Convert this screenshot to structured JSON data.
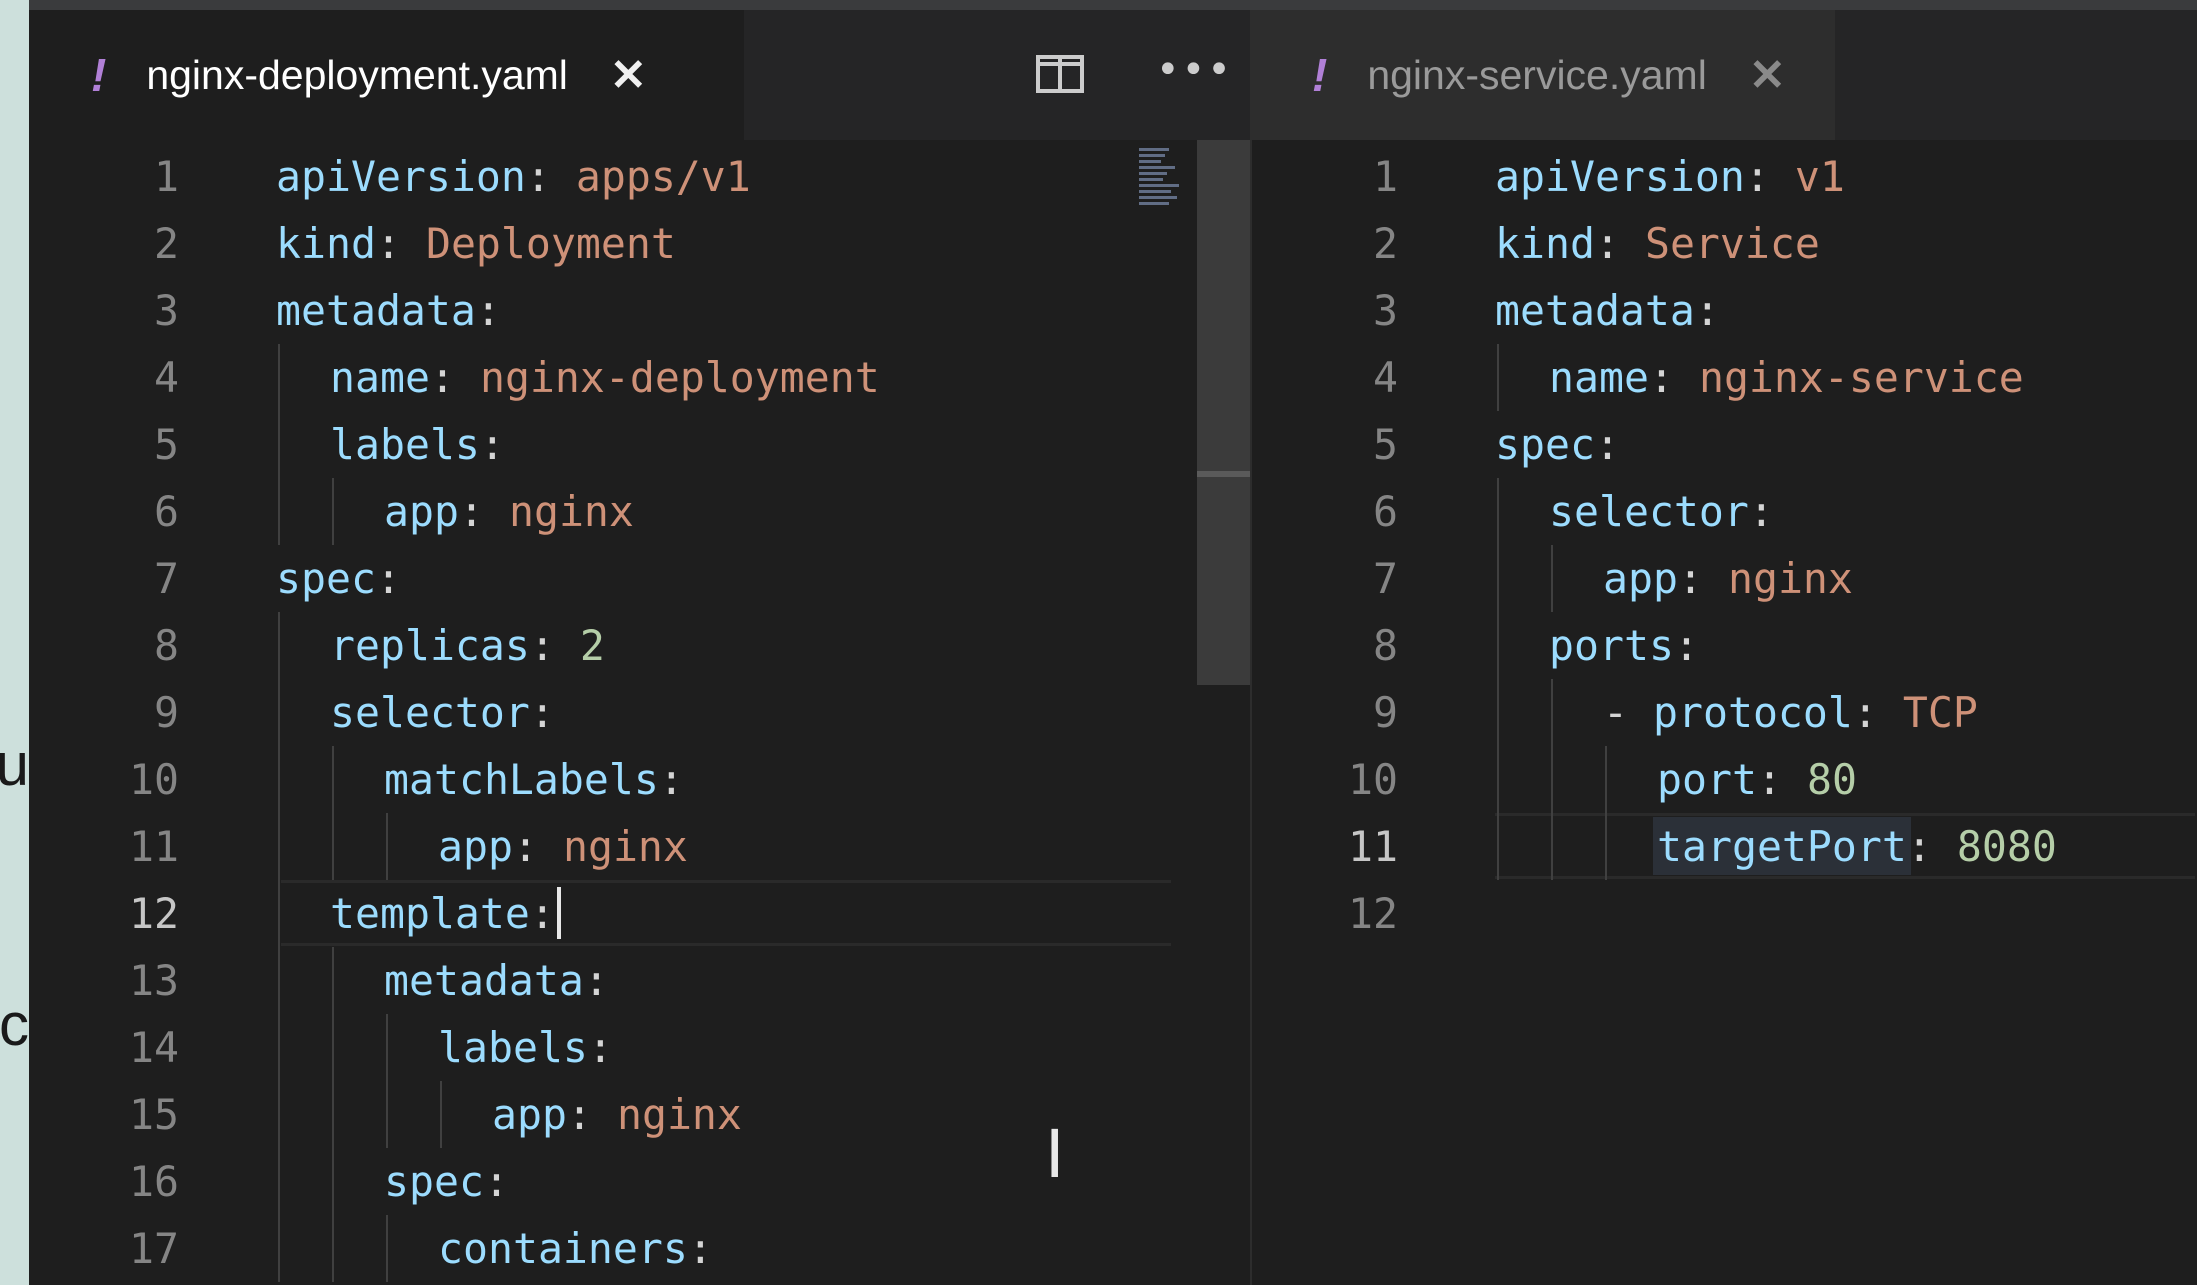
{
  "background_fragments": [
    "u",
    "c"
  ],
  "colors": {
    "key": "#9cdcfe",
    "string": "#ce9178",
    "number": "#b5cea8",
    "punctuation": "#d4d4d4",
    "line_number": "#858585",
    "tab_bang": "#b180d7"
  },
  "left_pane": {
    "tab": {
      "icon": "!",
      "filename": "nginx-deployment.yaml",
      "close": "✕",
      "active": true
    },
    "toolbar": {
      "split_icon": "split-editor-icon",
      "more": "•••"
    },
    "lines": [
      {
        "num": "1",
        "indent": 0,
        "key": "apiVersion",
        "value": "apps/v1",
        "vtype": "s"
      },
      {
        "num": "2",
        "indent": 0,
        "key": "kind",
        "value": "Deployment",
        "vtype": "s"
      },
      {
        "num": "3",
        "indent": 0,
        "key": "metadata",
        "value": "",
        "vtype": ""
      },
      {
        "num": "4",
        "indent": 1,
        "key": "name",
        "value": "nginx-deployment",
        "vtype": "s"
      },
      {
        "num": "5",
        "indent": 1,
        "key": "labels",
        "value": "",
        "vtype": ""
      },
      {
        "num": "6",
        "indent": 2,
        "key": "app",
        "value": "nginx",
        "vtype": "s"
      },
      {
        "num": "7",
        "indent": 0,
        "key": "spec",
        "value": "",
        "vtype": ""
      },
      {
        "num": "8",
        "indent": 1,
        "key": "replicas",
        "value": "2",
        "vtype": "n"
      },
      {
        "num": "9",
        "indent": 1,
        "key": "selector",
        "value": "",
        "vtype": ""
      },
      {
        "num": "10",
        "indent": 2,
        "key": "matchLabels",
        "value": "",
        "vtype": ""
      },
      {
        "num": "11",
        "indent": 3,
        "key": "app",
        "value": "nginx",
        "vtype": "s"
      },
      {
        "num": "12",
        "indent": 1,
        "key": "template",
        "value": "",
        "vtype": "",
        "current": true
      },
      {
        "num": "13",
        "indent": 2,
        "key": "metadata",
        "value": "",
        "vtype": ""
      },
      {
        "num": "14",
        "indent": 3,
        "key": "labels",
        "value": "",
        "vtype": ""
      },
      {
        "num": "15",
        "indent": 4,
        "key": "app",
        "value": "nginx",
        "vtype": "s"
      },
      {
        "num": "16",
        "indent": 2,
        "key": "spec",
        "value": "",
        "vtype": ""
      },
      {
        "num": "17",
        "indent": 3,
        "key": "containers",
        "value": "",
        "vtype": ""
      }
    ]
  },
  "right_pane": {
    "tab": {
      "icon": "!",
      "filename": "nginx-service.yaml",
      "close": "✕",
      "active": false
    },
    "lines": [
      {
        "num": "1",
        "indent": 0,
        "key": "apiVersion",
        "value": "v1",
        "vtype": "s"
      },
      {
        "num": "2",
        "indent": 0,
        "key": "kind",
        "value": "Service",
        "vtype": "s"
      },
      {
        "num": "3",
        "indent": 0,
        "key": "metadata",
        "value": "",
        "vtype": ""
      },
      {
        "num": "4",
        "indent": 1,
        "key": "name",
        "value": "nginx-service",
        "vtype": "s"
      },
      {
        "num": "5",
        "indent": 0,
        "key": "spec",
        "value": "",
        "vtype": ""
      },
      {
        "num": "6",
        "indent": 1,
        "key": "selector",
        "value": "",
        "vtype": ""
      },
      {
        "num": "7",
        "indent": 2,
        "key": "app",
        "value": "nginx",
        "vtype": "s"
      },
      {
        "num": "8",
        "indent": 1,
        "key": "ports",
        "value": "",
        "vtype": ""
      },
      {
        "num": "9",
        "indent": 2,
        "dash": "-",
        "key": "protocol",
        "value": "TCP",
        "vtype": "s"
      },
      {
        "num": "10",
        "indent": 3,
        "key": "port",
        "value": "80",
        "vtype": "n"
      },
      {
        "num": "11",
        "indent": 3,
        "key": "targetPort",
        "value": "8080",
        "vtype": "n",
        "current": true
      },
      {
        "num": "12",
        "indent": 0,
        "key": "",
        "value": "",
        "vtype": ""
      }
    ]
  }
}
